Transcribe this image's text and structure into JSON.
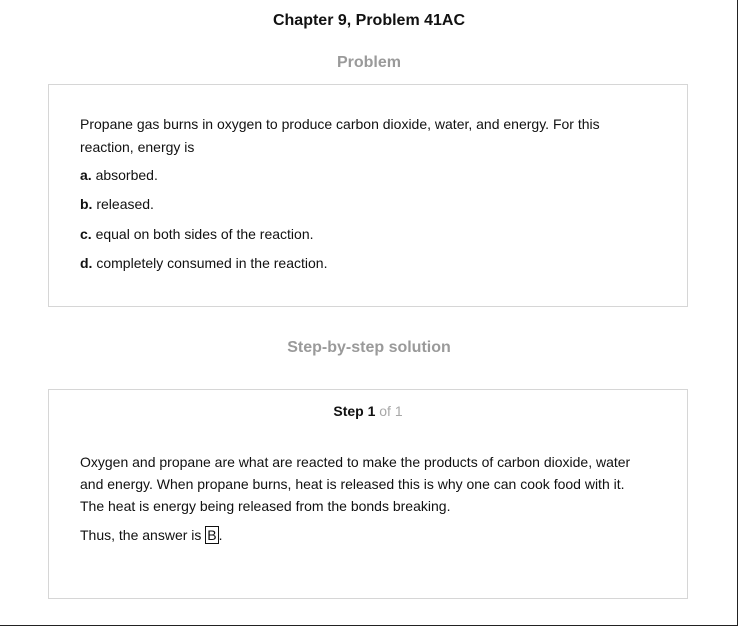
{
  "header": {
    "title": "Chapter 9, Problem 41AC"
  },
  "problem": {
    "heading": "Problem",
    "question": "Propane gas burns in oxygen to produce carbon dioxide, water, and energy. For this reaction, energy is",
    "options": [
      {
        "letter": "a.",
        "text": "absorbed."
      },
      {
        "letter": "b.",
        "text": "released."
      },
      {
        "letter": "c.",
        "text": "equal on both sides of the reaction."
      },
      {
        "letter": "d.",
        "text": "completely consumed in the reaction."
      }
    ]
  },
  "solution": {
    "heading": "Step-by-step solution",
    "step_label": "Step 1",
    "step_of": "of 1",
    "explanation": "Oxygen and propane are what are reacted to make the products of carbon dioxide, water and energy. When propane burns, heat is released this is why one can cook food with it. The heat is energy being released from the bonds breaking.",
    "answer_prefix": "Thus, the answer is ",
    "answer": "B",
    "answer_suffix": "."
  }
}
